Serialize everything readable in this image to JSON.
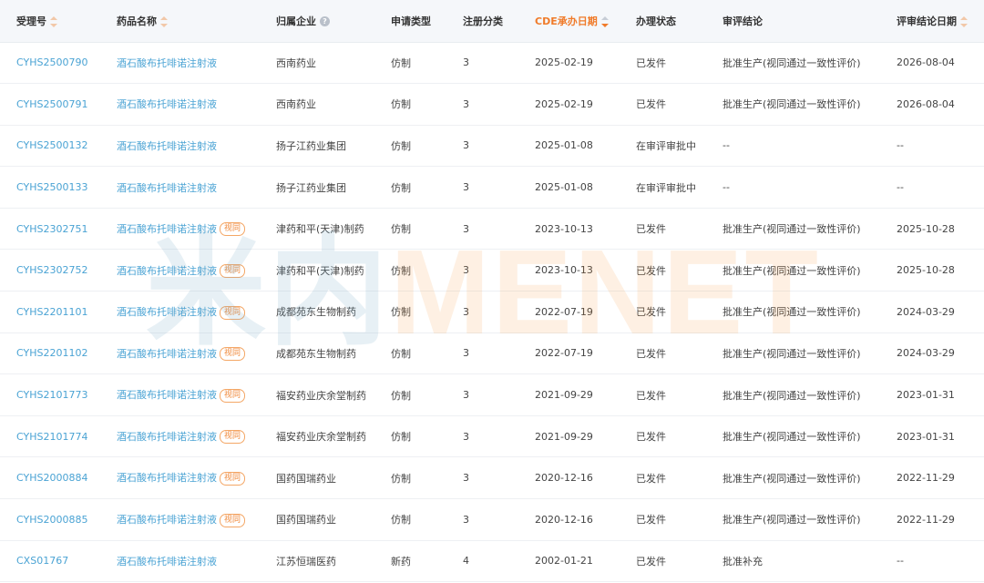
{
  "table": {
    "headers": [
      {
        "label": "受理号",
        "sort": "none"
      },
      {
        "label": "药品名称",
        "sort": "none"
      },
      {
        "label": "归属企业",
        "help": true
      },
      {
        "label": "申请类型"
      },
      {
        "label": "注册分类"
      },
      {
        "label": "CDE承办日期",
        "sort": "desc",
        "active": true
      },
      {
        "label": "办理状态"
      },
      {
        "label": "审评结论"
      },
      {
        "label": "评审结论日期",
        "sort": "none"
      }
    ],
    "badge_label": "视同",
    "rows": [
      {
        "id": "CYHS2500790",
        "drug": "酒石酸布托啡诺注射液",
        "badge": false,
        "company": "西南药业",
        "type": "仿制",
        "class": "3",
        "date": "2025-02-19",
        "status": "已发件",
        "conclusion": "批准生产(视同通过一致性评价)",
        "review_date": "2026-08-04"
      },
      {
        "id": "CYHS2500791",
        "drug": "酒石酸布托啡诺注射液",
        "badge": false,
        "company": "西南药业",
        "type": "仿制",
        "class": "3",
        "date": "2025-02-19",
        "status": "已发件",
        "conclusion": "批准生产(视同通过一致性评价)",
        "review_date": "2026-08-04"
      },
      {
        "id": "CYHS2500132",
        "drug": "酒石酸布托啡诺注射液",
        "badge": false,
        "company": "扬子江药业集团",
        "type": "仿制",
        "class": "3",
        "date": "2025-01-08",
        "status": "在审评审批中",
        "conclusion": "--",
        "review_date": "--"
      },
      {
        "id": "CYHS2500133",
        "drug": "酒石酸布托啡诺注射液",
        "badge": false,
        "company": "扬子江药业集团",
        "type": "仿制",
        "class": "3",
        "date": "2025-01-08",
        "status": "在审评审批中",
        "conclusion": "--",
        "review_date": "--"
      },
      {
        "id": "CYHS2302751",
        "drug": "酒石酸布托啡诺注射液",
        "badge": true,
        "company": "津药和平(天津)制药",
        "type": "仿制",
        "class": "3",
        "date": "2023-10-13",
        "status": "已发件",
        "conclusion": "批准生产(视同通过一致性评价)",
        "review_date": "2025-10-28"
      },
      {
        "id": "CYHS2302752",
        "drug": "酒石酸布托啡诺注射液",
        "badge": true,
        "company": "津药和平(天津)制药",
        "type": "仿制",
        "class": "3",
        "date": "2023-10-13",
        "status": "已发件",
        "conclusion": "批准生产(视同通过一致性评价)",
        "review_date": "2025-10-28"
      },
      {
        "id": "CYHS2201101",
        "drug": "酒石酸布托啡诺注射液",
        "badge": true,
        "company": "成都苑东生物制药",
        "type": "仿制",
        "class": "3",
        "date": "2022-07-19",
        "status": "已发件",
        "conclusion": "批准生产(视同通过一致性评价)",
        "review_date": "2024-03-29"
      },
      {
        "id": "CYHS2201102",
        "drug": "酒石酸布托啡诺注射液",
        "badge": true,
        "company": "成都苑东生物制药",
        "type": "仿制",
        "class": "3",
        "date": "2022-07-19",
        "status": "已发件",
        "conclusion": "批准生产(视同通过一致性评价)",
        "review_date": "2024-03-29"
      },
      {
        "id": "CYHS2101773",
        "drug": "酒石酸布托啡诺注射液",
        "badge": true,
        "company": "福安药业庆余堂制药",
        "type": "仿制",
        "class": "3",
        "date": "2021-09-29",
        "status": "已发件",
        "conclusion": "批准生产(视同通过一致性评价)",
        "review_date": "2023-01-31"
      },
      {
        "id": "CYHS2101774",
        "drug": "酒石酸布托啡诺注射液",
        "badge": true,
        "company": "福安药业庆余堂制药",
        "type": "仿制",
        "class": "3",
        "date": "2021-09-29",
        "status": "已发件",
        "conclusion": "批准生产(视同通过一致性评价)",
        "review_date": "2023-01-31"
      },
      {
        "id": "CYHS2000884",
        "drug": "酒石酸布托啡诺注射液",
        "badge": true,
        "company": "国药国瑞药业",
        "type": "仿制",
        "class": "3",
        "date": "2020-12-16",
        "status": "已发件",
        "conclusion": "批准生产(视同通过一致性评价)",
        "review_date": "2022-11-29"
      },
      {
        "id": "CYHS2000885",
        "drug": "酒石酸布托啡诺注射液",
        "badge": true,
        "company": "国药国瑞药业",
        "type": "仿制",
        "class": "3",
        "date": "2020-12-16",
        "status": "已发件",
        "conclusion": "批准生产(视同通过一致性评价)",
        "review_date": "2022-11-29"
      },
      {
        "id": "CXS01767",
        "drug": "酒石酸布托啡诺注射液",
        "badge": false,
        "company": "江苏恒瑞医药",
        "type": "新药",
        "class": "4",
        "date": "2002-01-21",
        "status": "已发件",
        "conclusion": "批准补充",
        "review_date": "--"
      }
    ]
  },
  "watermark": {
    "cn": "米内",
    "en": "MENET"
  },
  "colors": {
    "link": "#4aa3d4",
    "accent": "#f07b2a",
    "header_bg": "#f5f7fa"
  }
}
